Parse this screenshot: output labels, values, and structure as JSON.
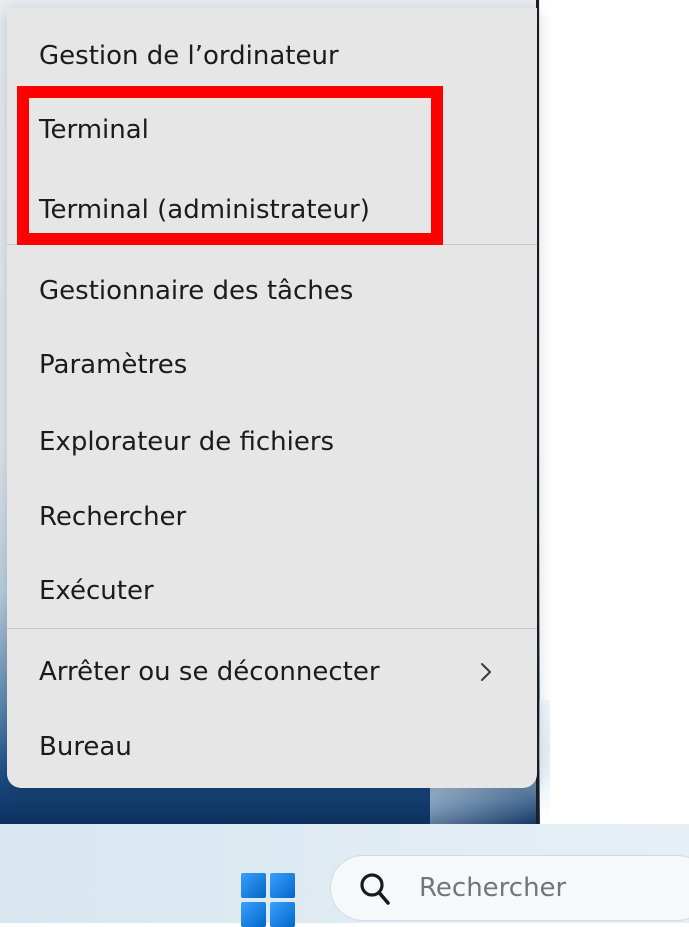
{
  "context_menu": {
    "items": [
      {
        "label": "Gestion de l’ordinateur"
      },
      {
        "label": "Terminal"
      },
      {
        "label": "Terminal (administrateur)"
      },
      {
        "label": "Gestionnaire des tâches"
      },
      {
        "label": "Paramètres"
      },
      {
        "label": "Explorateur de fichiers"
      },
      {
        "label": "Rechercher"
      },
      {
        "label": "Exécuter"
      },
      {
        "label": "Arrêter ou se déconnecter",
        "has_submenu": true
      },
      {
        "label": "Bureau"
      }
    ]
  },
  "taskbar": {
    "start_icon": "windows-logo-icon",
    "search": {
      "icon": "search-icon",
      "placeholder": "Rechercher"
    }
  },
  "colors": {
    "highlight": "#ff0000",
    "menu_background": "#e6e6e6",
    "start_blue": "#0078d4"
  }
}
